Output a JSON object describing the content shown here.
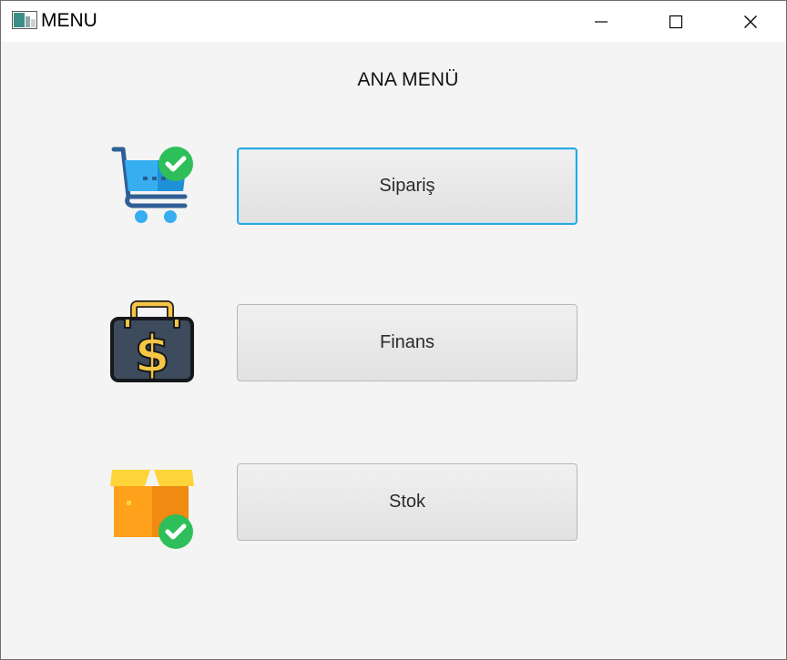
{
  "window": {
    "title": "MENU",
    "controls": [
      "minimize",
      "maximize",
      "close"
    ]
  },
  "main": {
    "heading": "ANA MENÜ",
    "items": [
      {
        "label": "Sipariş",
        "icon": "shopping-cart-check-icon",
        "focused": true
      },
      {
        "label": "Finans",
        "icon": "money-briefcase-icon",
        "focused": false
      },
      {
        "label": "Stok",
        "icon": "box-check-icon",
        "focused": false
      }
    ]
  },
  "colors": {
    "focus_border": "#2aa9e0",
    "button_top": "#f0f0f0",
    "button_bottom": "#e1e1e1",
    "background": "#f4f4f4",
    "check_green": "#2ebf5a"
  }
}
